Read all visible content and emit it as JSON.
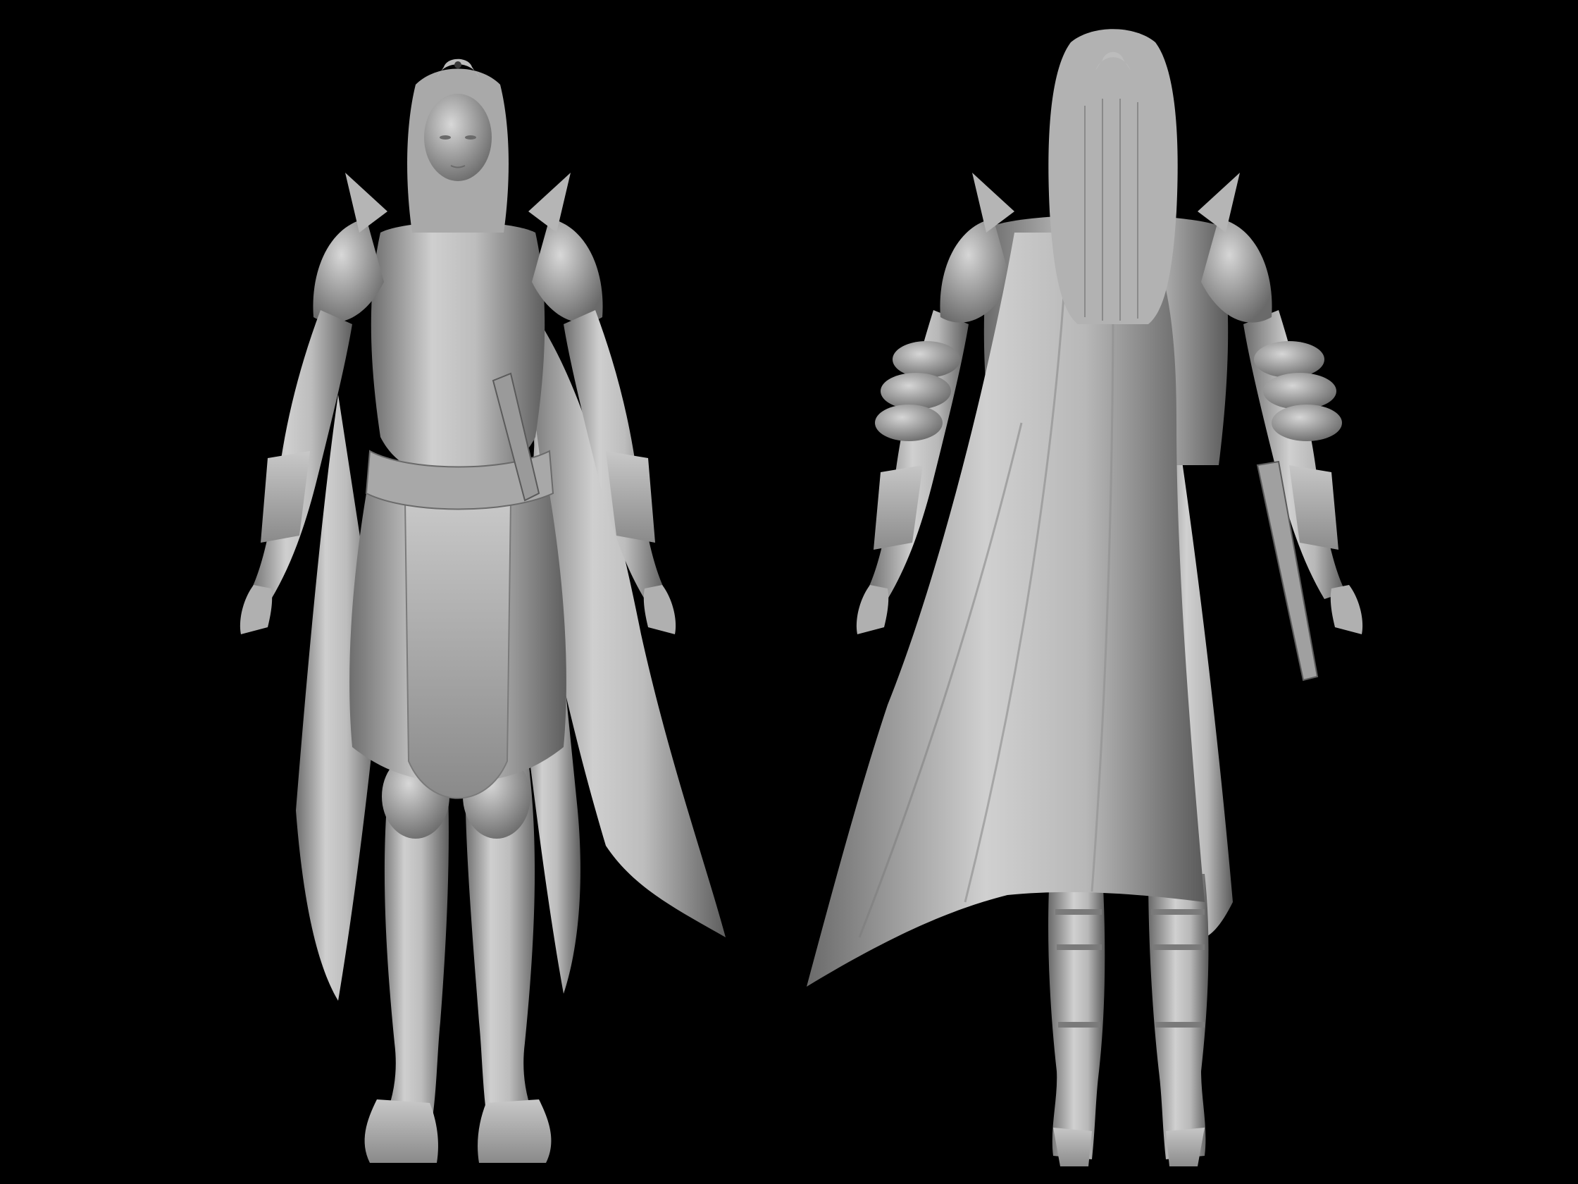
{
  "scene": {
    "background_color": "#000000",
    "clay_color_light": "#cfcfcf",
    "clay_color_mid": "#9a9a9a",
    "clay_color_dark": "#5c5c5c"
  },
  "views": [
    {
      "id": "front",
      "description_icon": "figure-front-icon"
    },
    {
      "id": "back",
      "description_icon": "figure-back-icon"
    }
  ]
}
